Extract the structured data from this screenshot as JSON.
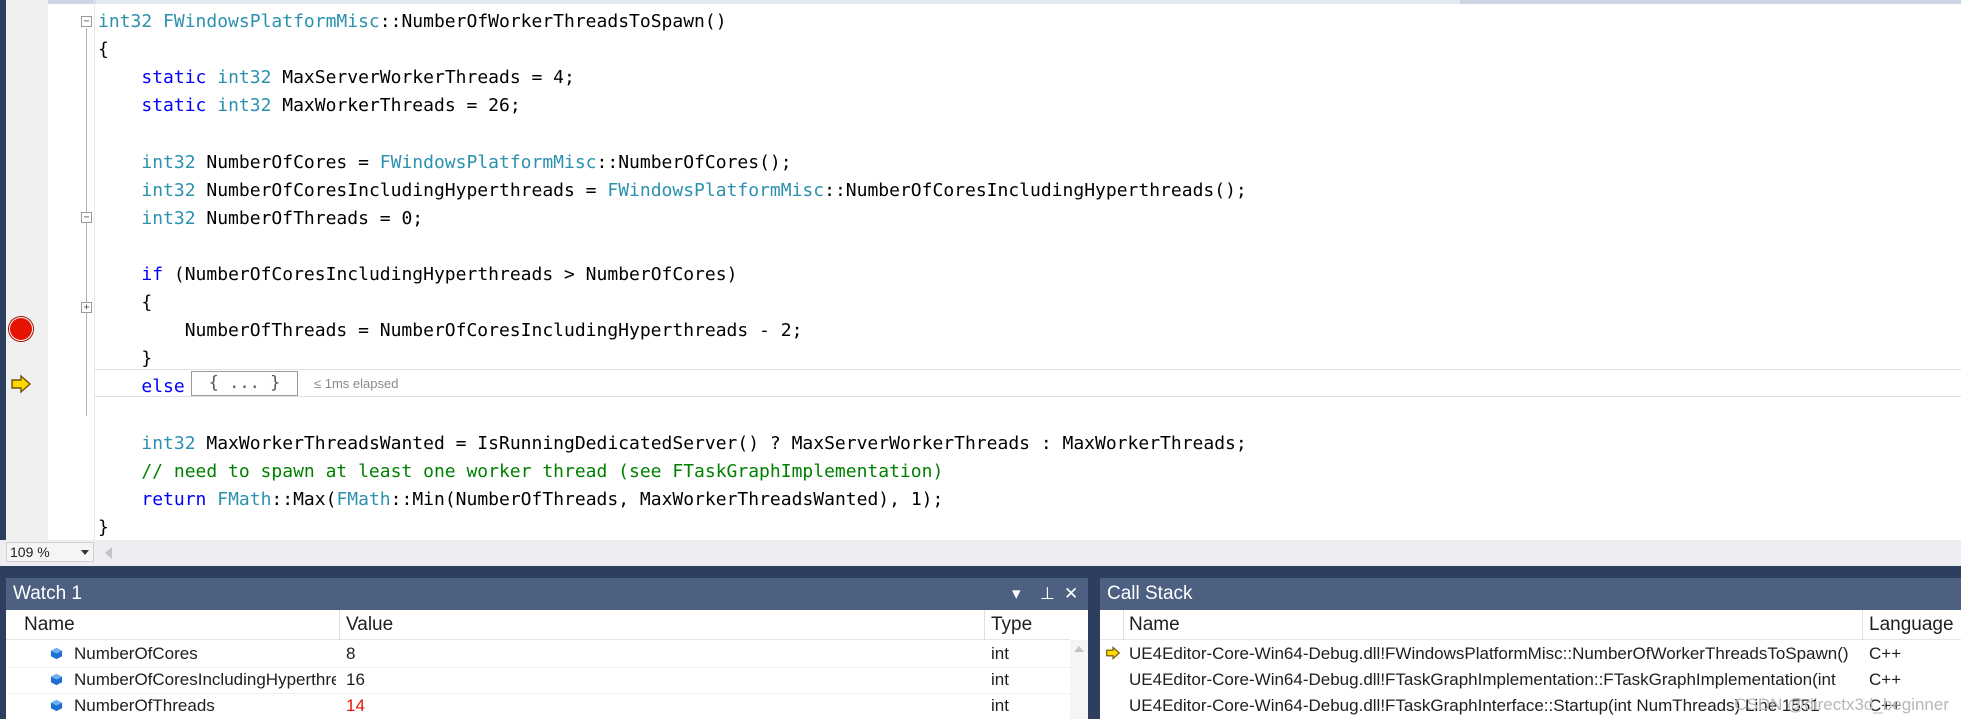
{
  "editor": {
    "lines": [
      [
        {
          "t": "int32 ",
          "c": "ty"
        },
        {
          "t": "FWindowsPlatformMisc",
          "c": "ty"
        },
        {
          "t": "::NumberOfWorkerThreadsToSpawn()",
          "c": "op"
        }
      ],
      [
        {
          "t": "{",
          "c": "op"
        }
      ],
      [
        {
          "t": "    ",
          "c": "op"
        },
        {
          "t": "static",
          "c": "kw"
        },
        {
          "t": " ",
          "c": "op"
        },
        {
          "t": "int32",
          "c": "ty"
        },
        {
          "t": " MaxServerWorkerThreads = 4;",
          "c": "op"
        }
      ],
      [
        {
          "t": "    ",
          "c": "op"
        },
        {
          "t": "static",
          "c": "kw"
        },
        {
          "t": " ",
          "c": "op"
        },
        {
          "t": "int32",
          "c": "ty"
        },
        {
          "t": " MaxWorkerThreads = 26;",
          "c": "op"
        }
      ],
      [],
      [
        {
          "t": "    ",
          "c": "op"
        },
        {
          "t": "int32",
          "c": "ty"
        },
        {
          "t": " NumberOfCores = ",
          "c": "op"
        },
        {
          "t": "FWindowsPlatformMisc",
          "c": "ty"
        },
        {
          "t": "::NumberOfCores();",
          "c": "op"
        }
      ],
      [
        {
          "t": "    ",
          "c": "op"
        },
        {
          "t": "int32",
          "c": "ty"
        },
        {
          "t": " NumberOfCoresIncludingHyperthreads = ",
          "c": "op"
        },
        {
          "t": "FWindowsPlatformMisc",
          "c": "ty"
        },
        {
          "t": "::NumberOfCoresIncludingHyperthreads();",
          "c": "op"
        }
      ],
      [
        {
          "t": "    ",
          "c": "op"
        },
        {
          "t": "int32",
          "c": "ty"
        },
        {
          "t": " NumberOfThreads = 0;",
          "c": "op"
        }
      ],
      [],
      [
        {
          "t": "    ",
          "c": "op"
        },
        {
          "t": "if",
          "c": "kw"
        },
        {
          "t": " (NumberOfCoresIncludingHyperthreads > NumberOfCores)",
          "c": "op"
        }
      ],
      [
        {
          "t": "    {",
          "c": "op"
        }
      ],
      [
        {
          "t": "        NumberOfThreads = NumberOfCoresIncludingHyperthreads - 2;",
          "c": "op"
        }
      ],
      [
        {
          "t": "    }",
          "c": "op"
        }
      ],
      [
        {
          "t": "    ",
          "c": "op"
        },
        {
          "t": "else",
          "c": "kw"
        }
      ],
      [],
      [
        {
          "t": "    ",
          "c": "op"
        },
        {
          "t": "int32",
          "c": "ty"
        },
        {
          "t": " MaxWorkerThreadsWanted = IsRunningDedicatedServer() ? MaxServerWorkerThreads : MaxWorkerThreads;",
          "c": "op"
        }
      ],
      [
        {
          "t": "    // need to spawn at least one worker thread (see FTaskGraphImplementation)",
          "c": "cm"
        }
      ],
      [
        {
          "t": "    ",
          "c": "op"
        },
        {
          "t": "return",
          "c": "kw"
        },
        {
          "t": " ",
          "c": "op"
        },
        {
          "t": "FMath",
          "c": "ty"
        },
        {
          "t": "::Max(",
          "c": "op"
        },
        {
          "t": "FMath",
          "c": "ty"
        },
        {
          "t": "::Min(NumberOfThreads, MaxWorkerThreadsWanted), 1);",
          "c": "op"
        }
      ],
      [
        {
          "t": "}",
          "c": "op"
        }
      ]
    ],
    "collapsed_block": "{ ... }",
    "elapsed": "≤ 1ms elapsed",
    "zoom": "109 %"
  },
  "watch": {
    "title": "Watch 1",
    "headers": {
      "name": "Name",
      "value": "Value",
      "type": "Type"
    },
    "rows": [
      {
        "name": "NumberOfCores",
        "value": "8",
        "type": "int",
        "changed": false
      },
      {
        "name": "NumberOfCoresIncludingHyperthreads",
        "value": "16",
        "type": "int",
        "changed": false
      },
      {
        "name": "NumberOfThreads",
        "value": "14",
        "type": "int",
        "changed": true
      }
    ],
    "buttons": {
      "dropdown": "▾",
      "pin": "⊥",
      "close": "✕"
    }
  },
  "callstack": {
    "title": "Call Stack",
    "headers": {
      "name": "Name",
      "language": "Language"
    },
    "rows": [
      {
        "name": "UE4Editor-Core-Win64-Debug.dll!FWindowsPlatformMisc::NumberOfWorkerThreadsToSpawn()",
        "language": "C++",
        "current": true
      },
      {
        "name": "UE4Editor-Core-Win64-Debug.dll!FTaskGraphImplementation::FTaskGraphImplementation(int",
        "language": "C++",
        "current": false
      },
      {
        "name": "UE4Editor-Core-Win64-Debug.dll!FTaskGraphInterface::Startup(int NumThreads) Line 1551",
        "language": "C++",
        "current": false
      }
    ]
  },
  "watermark": "CSDN @directx3d_beginner",
  "colors": {
    "keyword": "#0000ff",
    "type": "#2b91af",
    "comment": "#008000",
    "changed_value": "#e51400",
    "panel_title": "#4d6082"
  }
}
